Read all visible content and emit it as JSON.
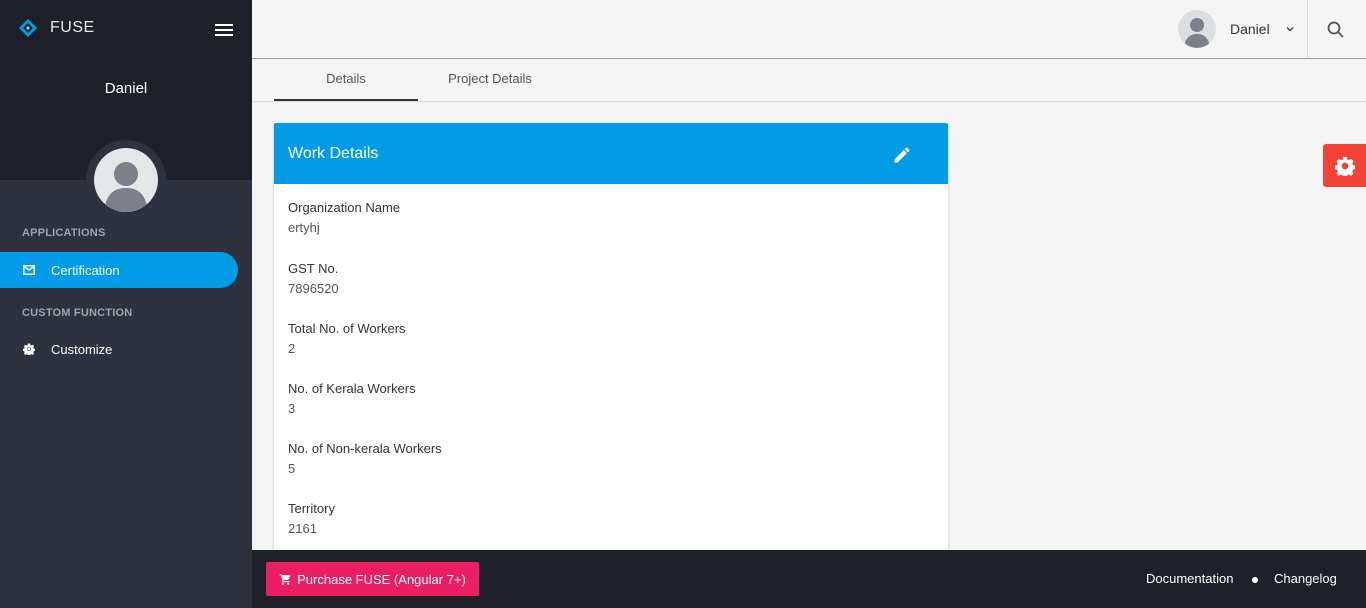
{
  "app": {
    "name": "FUSE"
  },
  "sidebar": {
    "user_name": "Daniel",
    "sections": [
      {
        "title": "APPLICATIONS",
        "items": [
          {
            "label": "Certification",
            "icon": "mail-icon",
            "active": true
          }
        ]
      },
      {
        "title": "CUSTOM FUNCTION",
        "items": [
          {
            "label": "Customize",
            "icon": "gear-icon",
            "active": false
          }
        ]
      }
    ]
  },
  "toolbar": {
    "user_name": "Daniel"
  },
  "tabs": [
    {
      "label": "Details",
      "active": true
    },
    {
      "label": "Project Details",
      "active": false
    }
  ],
  "card": {
    "title": "Work Details",
    "fields": [
      {
        "label": "Organization Name",
        "value": "ertyhj"
      },
      {
        "label": "GST No.",
        "value": "7896520"
      },
      {
        "label": "Total No. of Workers",
        "value": "2"
      },
      {
        "label": "No. of Kerala Workers",
        "value": "3"
      },
      {
        "label": "No. of Non-kerala Workers",
        "value": "5"
      },
      {
        "label": "Territory",
        "value": "2161"
      }
    ]
  },
  "footer": {
    "purchase_label": "Purchase FUSE (Angular 7+)",
    "links": [
      "Documentation",
      "Changelog"
    ]
  },
  "colors": {
    "primary": "#039be5",
    "accent": "#e91e63",
    "fab": "#f44336",
    "sidebar": "#2d323e",
    "sidebar_dark": "#1e2129"
  }
}
